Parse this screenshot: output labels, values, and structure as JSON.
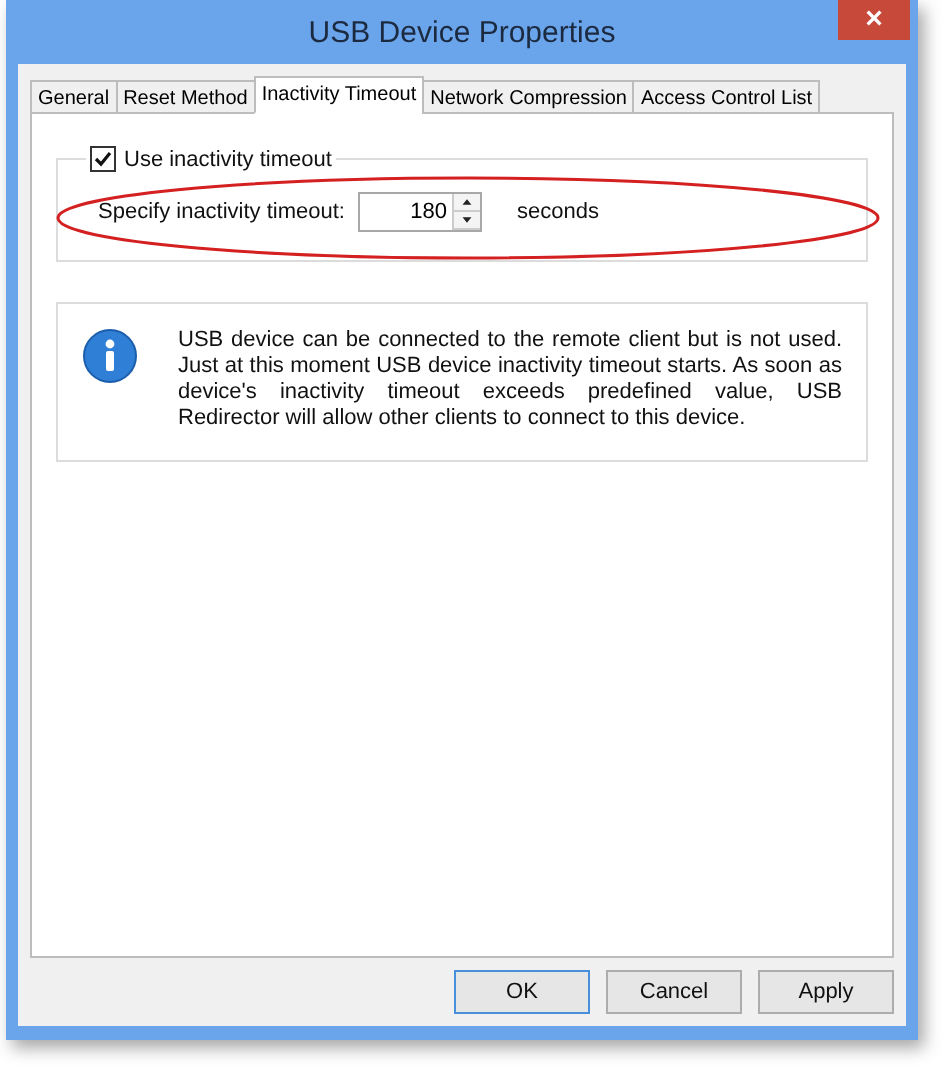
{
  "window": {
    "title": "USB Device Properties",
    "close": "×"
  },
  "tabs": [
    {
      "label": "General",
      "selected": false
    },
    {
      "label": "Reset Method",
      "selected": false
    },
    {
      "label": "Inactivity Timeout",
      "selected": true
    },
    {
      "label": "Network Compression",
      "selected": false
    },
    {
      "label": "Access Control List",
      "selected": false
    }
  ],
  "timeout_group": {
    "checkbox": {
      "label": "Use inactivity timeout",
      "checked": true
    },
    "label": "Specify inactivity timeout:",
    "value": "180",
    "unit": "seconds",
    "highlighted": true
  },
  "info": {
    "text": "USB  device  can be connected to the remote client but is not used. Just at this moment USB device inactivity timeout starts. As soon as device's inactivity timeout exceeds predefined value, USB Redirector will allow other clients to connect to this device."
  },
  "buttons": [
    {
      "label": "OK",
      "selected": true
    },
    {
      "label": "Cancel",
      "selected": false
    },
    {
      "label": "Apply",
      "selected": false
    }
  ]
}
